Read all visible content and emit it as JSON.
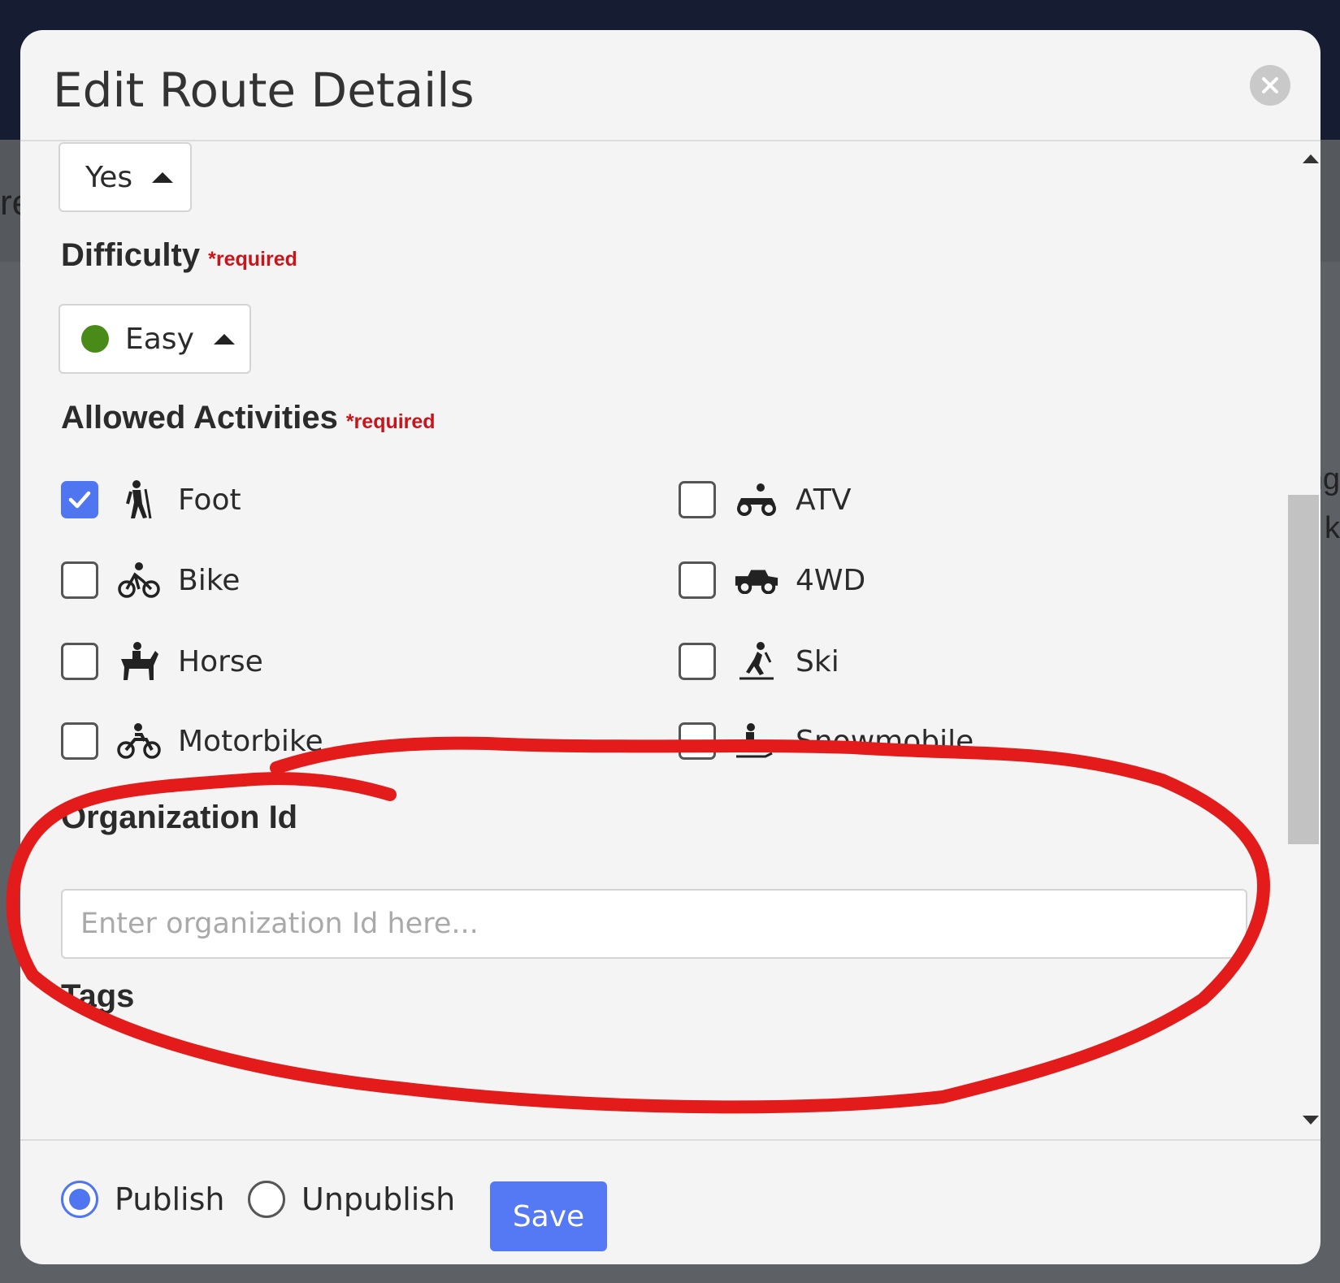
{
  "modal": {
    "title": "Edit Route Details"
  },
  "form": {
    "yes_select": {
      "value": "Yes"
    },
    "difficulty": {
      "label": "Difficulty",
      "required": "*required",
      "value": "Easy",
      "dot_color": "#4a8a18"
    },
    "activities": {
      "label": "Allowed Activities",
      "required": "*required",
      "items": [
        {
          "label": "Foot",
          "icon": "hiker-icon",
          "checked": true
        },
        {
          "label": "Bike",
          "icon": "bicycle-icon",
          "checked": false
        },
        {
          "label": "Horse",
          "icon": "horse-rider-icon",
          "checked": false
        },
        {
          "label": "Motorbike",
          "icon": "motorbike-icon",
          "checked": false
        },
        {
          "label": "ATV",
          "icon": "atv-icon",
          "checked": false
        },
        {
          "label": "4WD",
          "icon": "jeep-icon",
          "checked": false
        },
        {
          "label": "Ski",
          "icon": "skier-icon",
          "checked": false
        },
        {
          "label": "Snowmobile",
          "icon": "snowmobile-icon",
          "checked": false
        }
      ]
    },
    "organization": {
      "label": "Organization Id",
      "placeholder": "Enter organization Id here...",
      "value": ""
    },
    "tags": {
      "label": "Tags"
    }
  },
  "footer": {
    "publish_label": "Publish",
    "unpublish_label": "Unpublish",
    "selected": "Publish",
    "save_label": "Save"
  },
  "colors": {
    "accent": "#5578f4",
    "required": "#c8151b",
    "annotation": "#e41b1b",
    "topbar": "#161c31"
  }
}
